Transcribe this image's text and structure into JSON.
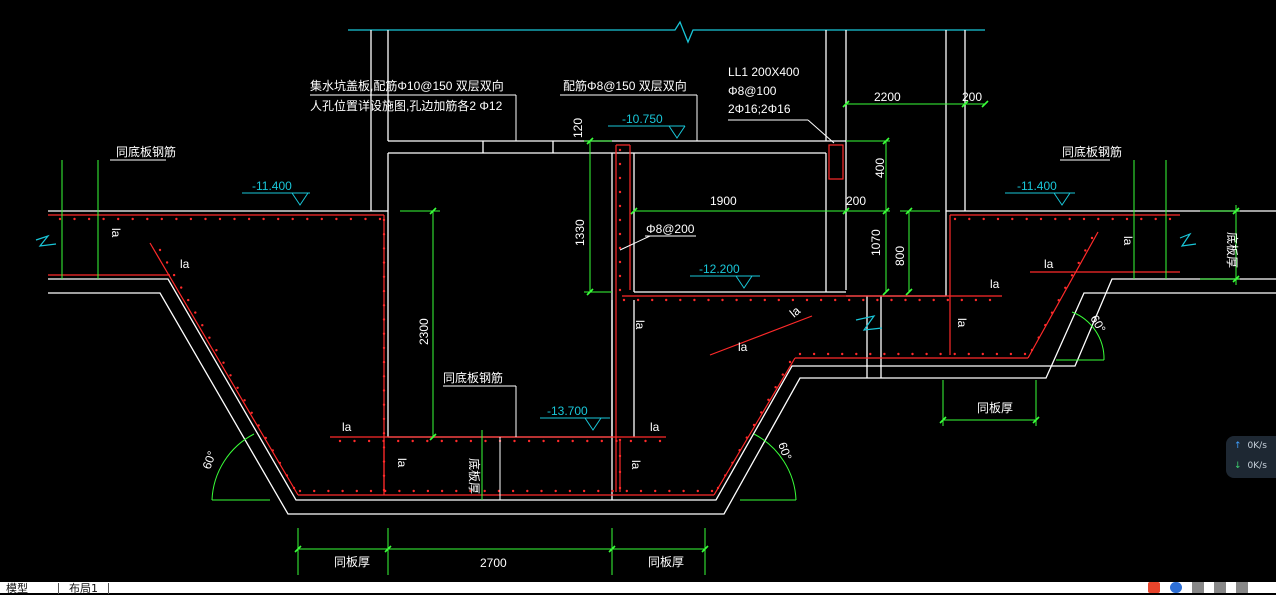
{
  "labels": {
    "pit_cover": "集水坑盖板,配筋Φ10@150 双层双向",
    "manhole": "人孔位置详设施图,孔边加筋各2 Φ12",
    "cover_reinf": "配筋Φ8@150 双层双向",
    "beam_name": "LL1 200X400",
    "beam_stirrup": "Φ8@100",
    "beam_bars": "2Φ16;2Φ16",
    "same_bottom_left": "同底板钢筋",
    "same_bottom_right": "同底板钢筋",
    "same_bottom_center": "同底板钢筋",
    "wall_reinf": "Φ8@200",
    "slab_thk_left": "底板厚",
    "slab_thk_right": "底板厚",
    "slab_thk_center": "底板厚",
    "same_slab_thk_1": "同板厚",
    "same_slab_thk_2": "同板厚",
    "same_slab_thk_3": "同板厚",
    "la": "la"
  },
  "elevations": {
    "top": "-10.750",
    "left": "-11.400",
    "right": "-11.400",
    "mid": "-12.200",
    "bottom": "-13.700"
  },
  "dimensions": {
    "d2200": "2200",
    "d200a": "200",
    "d200b": "200",
    "d120": "120",
    "d400": "400",
    "d1900": "1900",
    "d1330": "1330",
    "d1070": "1070",
    "d800": "800",
    "d2300": "2300",
    "d2700": "2700",
    "angle": "60°"
  },
  "status": {
    "up": "0K/s",
    "down": "0K/s"
  },
  "tabs": {
    "model": "模型",
    "layout": "布局1"
  },
  "colors": {
    "concrete": "#ffffff",
    "rebar": "#ff2a2a",
    "dimension": "#39ff39",
    "elevation": "#19c6d8",
    "leader": "#ffffff"
  }
}
